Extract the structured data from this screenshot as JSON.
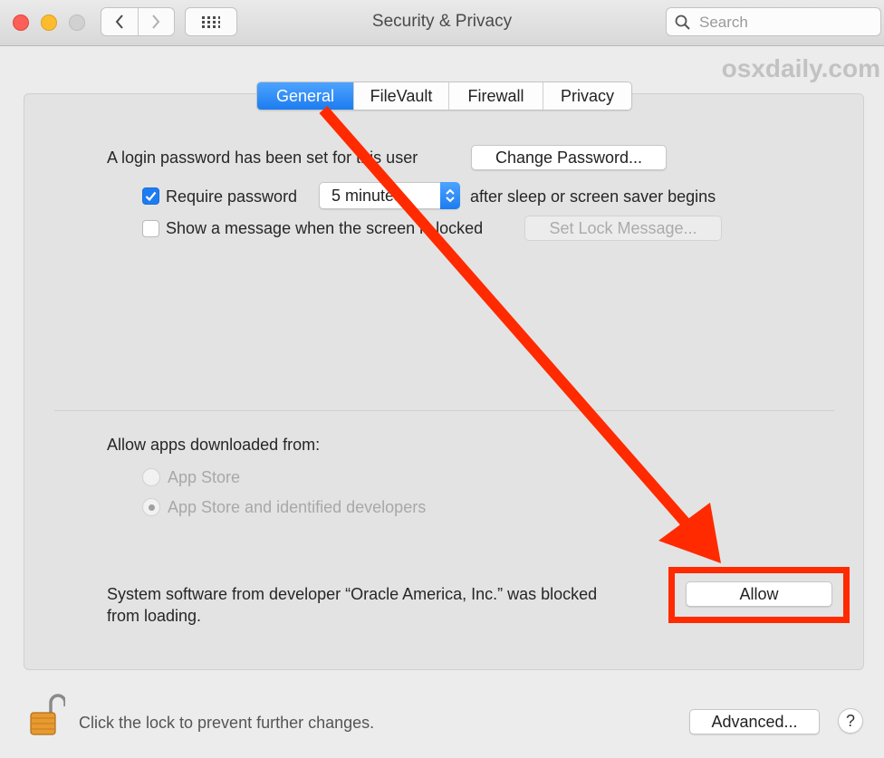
{
  "window": {
    "title": "Security & Privacy",
    "search_placeholder": "Search",
    "watermark": "osxdaily.com"
  },
  "tabs": [
    {
      "label": "General",
      "active": true
    },
    {
      "label": "FileVault",
      "active": false
    },
    {
      "label": "Firewall",
      "active": false
    },
    {
      "label": "Privacy",
      "active": false
    }
  ],
  "general": {
    "login_password_text": "A login password has been set for this user",
    "change_password_label": "Change Password...",
    "require_password_label": "Require password",
    "require_password_checked": true,
    "require_password_delay": "5 minutes",
    "require_password_suffix": "after sleep or screen saver begins",
    "show_message_label": "Show a message when the screen is locked",
    "show_message_checked": false,
    "set_lock_message_label": "Set Lock Message..."
  },
  "downloads": {
    "heading": "Allow apps downloaded from:",
    "options": [
      {
        "label": "App Store",
        "selected": false
      },
      {
        "label": "App Store and identified developers",
        "selected": true
      }
    ]
  },
  "blocked": {
    "line1": "System software from developer “Oracle America, Inc.” was blocked",
    "line2": "from loading.",
    "allow_label": "Allow"
  },
  "footer": {
    "lock_text": "Click the lock to prevent further changes.",
    "advanced_label": "Advanced...",
    "help_label": "?"
  },
  "icons": {
    "back": "chevron-left-icon",
    "forward": "chevron-right-icon",
    "show_all": "grid-icon",
    "search": "search-icon",
    "lock": "unlocked-padlock-icon"
  },
  "colors": {
    "accent": "#1d7cf2",
    "annotation": "#ff2a00",
    "close": "#fc5f57",
    "minimize": "#fdbc2e"
  }
}
